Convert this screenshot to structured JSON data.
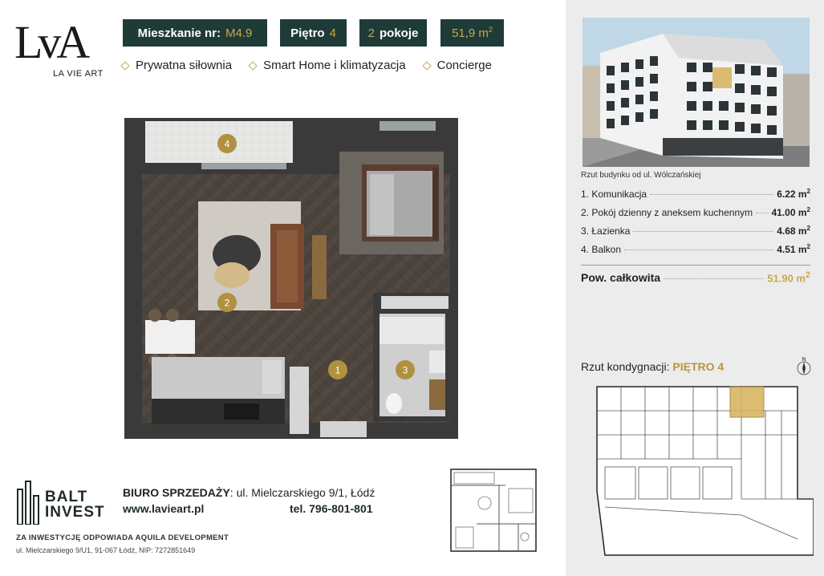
{
  "brand": {
    "logo_mark": "LvA",
    "logo_name": "LA VIE ART"
  },
  "header": {
    "apartment_label": "Mieszkanie nr:",
    "apartment_number": "M4.9",
    "floor_label": "Piętro",
    "floor_number": "4",
    "rooms_number": "2",
    "rooms_label": "pokoje",
    "area_value": "51,9 m",
    "area_sup": "2"
  },
  "amenities": [
    "Prywatna siłownia",
    "Smart Home i klimatyzacja",
    "Concierge"
  ],
  "plan_labels": [
    "1",
    "2",
    "3",
    "4"
  ],
  "right_panel": {
    "photo_caption": "Rzut budynku od ul. Wólczańskiej",
    "rooms": [
      {
        "name": "1. Komunikacja",
        "area": "6.22 m",
        "sup": "2"
      },
      {
        "name": "2. Pokój dzienny z aneksem kuchennym",
        "area": "41.00 m",
        "sup": "2"
      },
      {
        "name": "3. Łazienka",
        "area": "4.68 m",
        "sup": "2"
      },
      {
        "name": "4. Balkon",
        "area": "4.51 m",
        "sup": "2"
      }
    ],
    "total_label": "Pow. całkowita",
    "total_value": "51.90 m",
    "total_sup": "2",
    "floor_caption": "Rzut kondygnacji:",
    "floor_caption_value": "PIĘTRO 4",
    "compass_letter": "N"
  },
  "footer": {
    "developer_name_line1": "BALT",
    "developer_name_line2": "INVEST",
    "office_label": "BIURO SPRZEDAŻY",
    "office_address": ": ul. Mielczarskiego 9/1, Łódź",
    "website": "www.lavieart.pl",
    "phone": "tel. 796-801-801",
    "investor_note": "ZA INWESTYCJĘ ODPOWIADA AQUILA DEVELOPMENT",
    "investor_address": "ul. Mielczarskiego 9/U1, 91-067 Łódź, NIP: 7272851649"
  },
  "colors": {
    "dark_green": "#1f3b38",
    "gold": "#c9a949",
    "panel_gray": "#ececec",
    "floor_wood": "#4a423c",
    "wall": "#3a3a3a"
  }
}
